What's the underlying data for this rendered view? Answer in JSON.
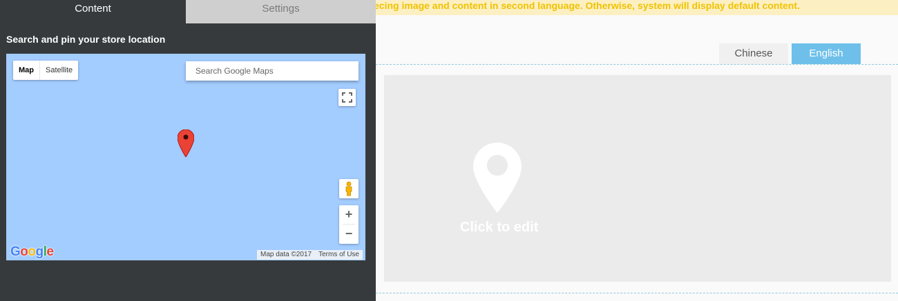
{
  "notice": {
    "text": "ecing image and content in second language. Otherwise, system will display default content."
  },
  "panel": {
    "tabs": [
      {
        "label": "Content"
      },
      {
        "label": "Settings"
      }
    ],
    "heading": "Search and pin your store location"
  },
  "map": {
    "type_options": [
      {
        "label": "Map"
      },
      {
        "label": "Satellite"
      }
    ],
    "search": {
      "placeholder": "Search Google Maps",
      "value": ""
    },
    "zoom_in": "+",
    "zoom_out": "−",
    "logo_letters": [
      "G",
      "o",
      "o",
      "g",
      "l",
      "e"
    ],
    "attribution": {
      "data": "Map data ©2017",
      "terms": "Terms of Use"
    }
  },
  "editor": {
    "lang_tabs": [
      {
        "label": "Chinese"
      },
      {
        "label": "English"
      }
    ],
    "placeholder_label": "Click to edit"
  },
  "colors": {
    "panel_bg": "#363a3d",
    "map_water": "#a3ccff",
    "active_lang": "#6ec0ea",
    "notice_bg": "#fcf0c3",
    "notice_text": "#f0c200",
    "marker": "#ea4335"
  }
}
